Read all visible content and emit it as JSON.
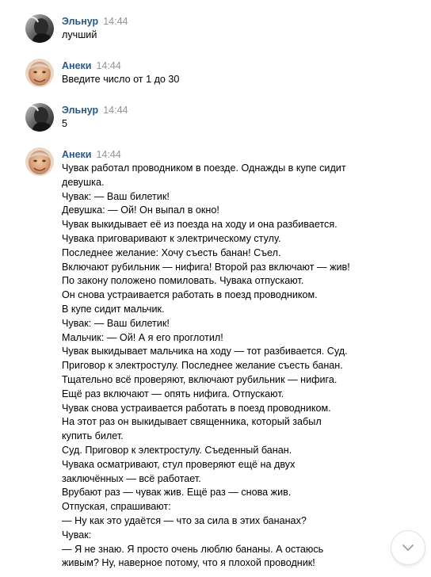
{
  "messages": [
    {
      "author": "Эльнур",
      "time": "14:44",
      "avatar": "avatar-dark-photo",
      "lines": [
        "лучший"
      ]
    },
    {
      "author": "Анеки",
      "time": "14:44",
      "avatar": "avatar-face-photo",
      "lines": [
        "Введите число от 1 до 30"
      ]
    },
    {
      "author": "Эльнур",
      "time": "14:44",
      "avatar": "avatar-dark-photo",
      "lines": [
        "5"
      ]
    },
    {
      "author": "Анеки",
      "time": "14:44",
      "avatar": "avatar-face-photo",
      "lines": [
        "Чувак работал проводником в поезде. Однажды в купе сидит",
        "девушка.",
        "Чувак: — Ваш билетик!",
        "Девушка: — Ой! Он выпал в окно!",
        "Чувак выкидывает её из поезда на ходу и она разбивается.",
        "Чувака приговаривают к электрическому стулу.",
        "Последнее желание: Хочу съесть банан! Съел.",
        "Включают рубильник — нифига! Второй раз включают — жив!",
        "По закону положено помиловать. Чувака отпускают.",
        "Он снова устраивается работать в поезд проводником.",
        "В купе сидит мальчик.",
        "Чувак: — Ваш билетик!",
        "Мальчик: — Ой! А я его проглотил!",
        "Чувак выкидывает мальчика на ходу — тот разбивается. Суд.",
        "Приговор к электростулу. Последнее желание съесть банан.",
        "Тщательно всё проверяют, включают рубильник — нифига.",
        "Ещё раз включают — опять нифига. Отпускают.",
        "Чувак снова устраивается работать в поезд проводником.",
        "На этот раз он выкидывает священника, который забыл",
        "купить билет.",
        "Суд. Приговор к электростулу. Съеденный банан.",
        "Чувака осматривают, стул проверяют ещё на двух",
        "заключённых — всё работает.",
        "Врубают раз — чувак жив. Ещё раз — снова жив.",
        "Отпуская, спрашивают:",
        "— Ну как это удаётся — что за сила в этих бананах?",
        "Чувак:",
        "— Я не знаю. Я просто очень люблю бананы. А остаюсь",
        "живым? Ну, наверное потому, что я плохой проводник!"
      ]
    }
  ],
  "scroll_button": {
    "icon": "chevron-down-icon"
  },
  "colors": {
    "author": "#2a5885",
    "time": "#939393",
    "text": "#000000",
    "background": "#ffffff"
  }
}
